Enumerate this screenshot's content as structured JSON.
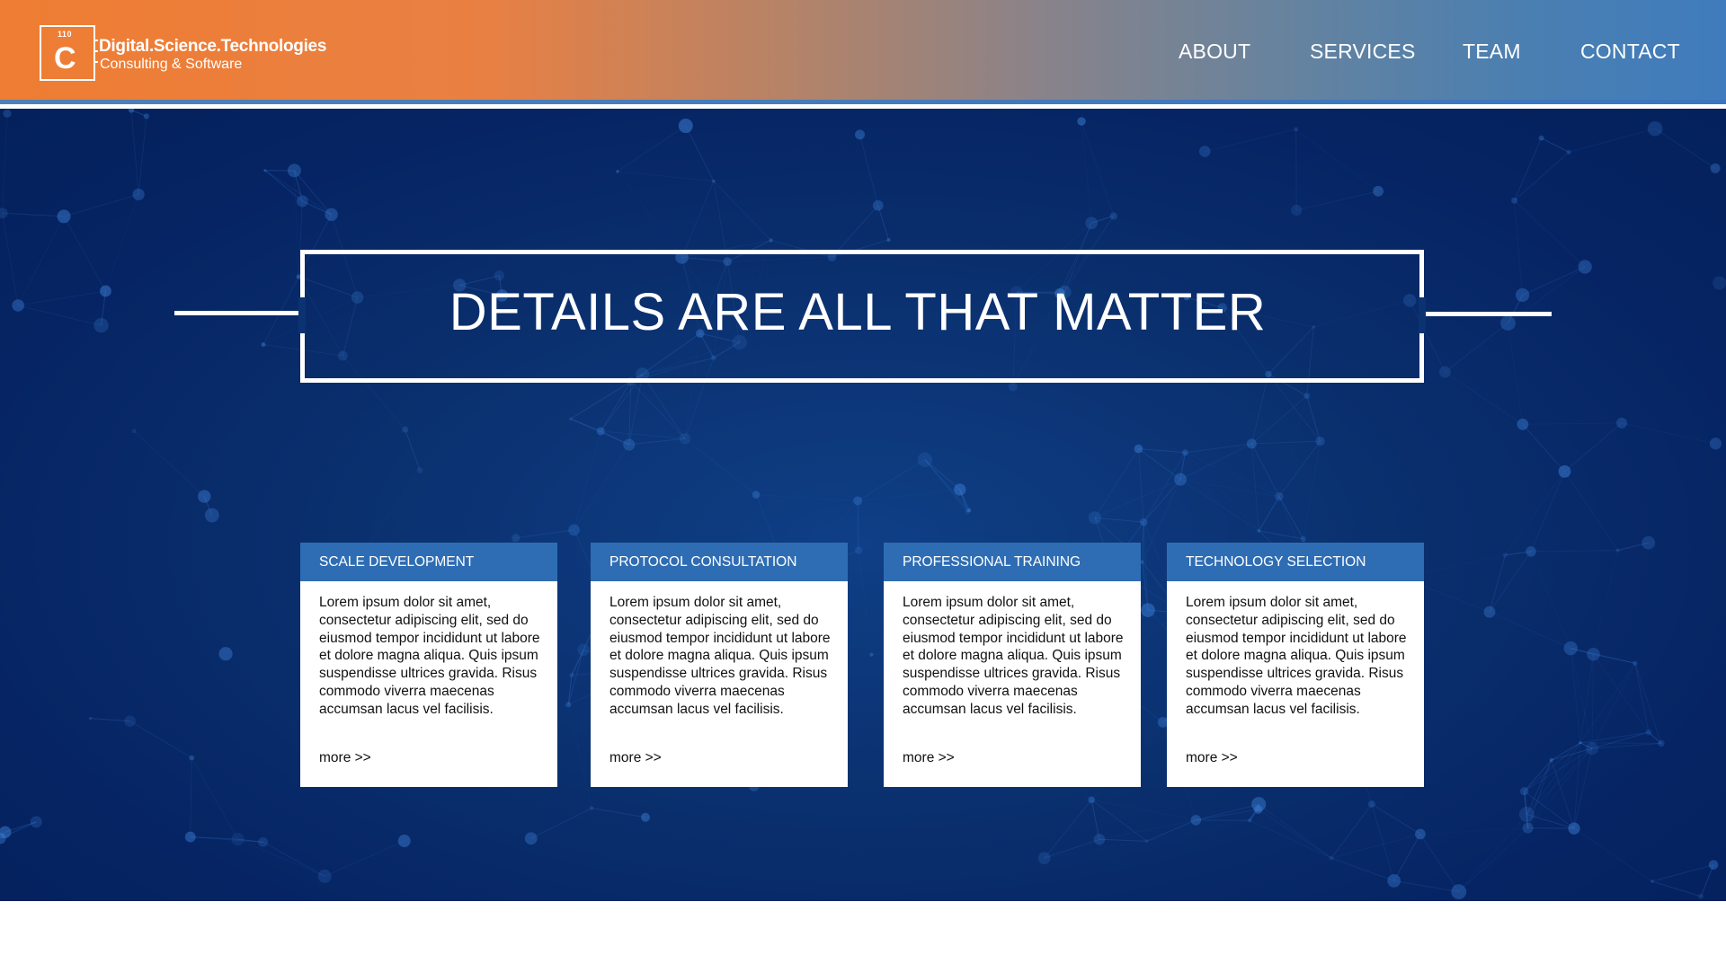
{
  "brand": {
    "logo_small": "110",
    "logo_letter": "C",
    "name": "Digital.Science.Technologies",
    "tagline": "Consulting & Software"
  },
  "nav": {
    "items": [
      {
        "label": "ABOUT"
      },
      {
        "label": "SERVICES"
      },
      {
        "label": "TEAM"
      },
      {
        "label": "CONTACT"
      }
    ]
  },
  "hero": {
    "title": "DETAILS ARE ALL THAT MATTER"
  },
  "cards": [
    {
      "title": "SCALE DEVELOPMENT",
      "body": "Lorem ipsum dolor sit amet, consectetur adipiscing elit, sed do eiusmod tempor incididunt ut labore et dolore magna aliqua. Quis ipsum suspendisse ultrices gravida. Risus commodo viverra maecenas accumsan lacus vel facilisis.",
      "more": "more >>"
    },
    {
      "title": "PROTOCOL CONSULTATION",
      "body": "Lorem ipsum dolor sit amet, consectetur adipiscing elit, sed do eiusmod tempor incididunt ut labore et dolore magna aliqua. Quis ipsum suspendisse ultrices gravida. Risus commodo viverra maecenas accumsan lacus vel facilisis.",
      "more": "more >>"
    },
    {
      "title": "PROFESSIONAL TRAINING",
      "body": "Lorem ipsum dolor sit amet, consectetur adipiscing elit, sed do eiusmod tempor incididunt ut labore et dolore magna aliqua. Quis ipsum suspendisse ultrices gravida. Risus commodo viverra maecenas accumsan lacus vel facilisis.",
      "more": "more >>"
    },
    {
      "title": "TECHNOLOGY SELECTION",
      "body": "Lorem ipsum dolor sit amet, consectetur adipiscing elit, sed do eiusmod tempor incididunt ut labore et dolore magna aliqua. Quis ipsum suspendisse ultrices gravida. Risus commodo viverra maecenas accumsan lacus vel facilisis.",
      "more": "more >>"
    }
  ],
  "colors": {
    "header_orange": "#ef7d33",
    "header_blue": "#3f7cbd",
    "hero_navy": "#062463",
    "card_header_blue": "#2e6db4",
    "text_white": "#ffffff"
  },
  "icons": {
    "logo": "circuit-chip-logo-icon",
    "background": "network-constellation-background"
  }
}
